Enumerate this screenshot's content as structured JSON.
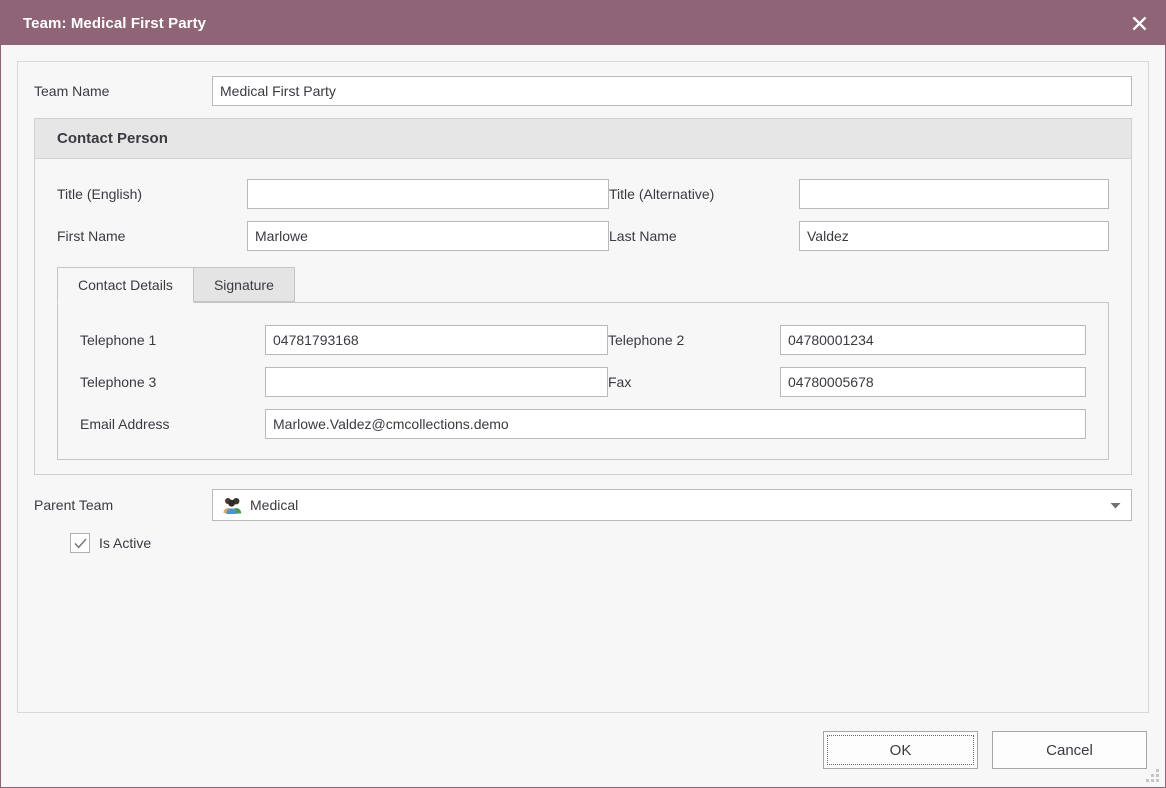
{
  "window": {
    "title": "Team: Medical First Party",
    "close_icon": "close-icon",
    "accent_color": "#8e6476"
  },
  "form": {
    "team_name": {
      "label": "Team Name",
      "value": "Medical First Party",
      "placeholder": ""
    }
  },
  "contact_person": {
    "legend": "Contact Person",
    "title_english": {
      "label": "Title (English)",
      "value": "",
      "placeholder": ""
    },
    "title_alternative": {
      "label": "Title (Alternative)",
      "value": "",
      "placeholder": ""
    },
    "first_name": {
      "label": "First Name",
      "value": "Marlowe",
      "placeholder": ""
    },
    "last_name": {
      "label": "Last Name",
      "value": "Valdez",
      "placeholder": ""
    },
    "tabs": [
      {
        "label": "Contact Details",
        "active": true
      },
      {
        "label": "Signature",
        "active": false
      }
    ],
    "contact_details": {
      "telephone_1": {
        "label": "Telephone 1",
        "value": "04781793168",
        "placeholder": ""
      },
      "telephone_2": {
        "label": "Telephone 2",
        "value": "04780001234",
        "placeholder": ""
      },
      "telephone_3": {
        "label": "Telephone 3",
        "value": "",
        "placeholder": ""
      },
      "fax": {
        "label": "Fax",
        "value": "04780005678",
        "placeholder": ""
      },
      "email": {
        "label": "Email Address",
        "value": "Marlowe.Valdez@cmcollections.demo",
        "placeholder": ""
      }
    }
  },
  "parent_team": {
    "label": "Parent Team",
    "value": "Medical",
    "icon": "users-group-icon",
    "arrow_icon": "chevron-down-icon"
  },
  "is_active": {
    "label": "Is Active",
    "checked": true,
    "check_icon": "checkmark-icon"
  },
  "footer": {
    "ok_label": "OK",
    "cancel_label": "Cancel"
  },
  "resize_grip": "resize-grip-icon"
}
